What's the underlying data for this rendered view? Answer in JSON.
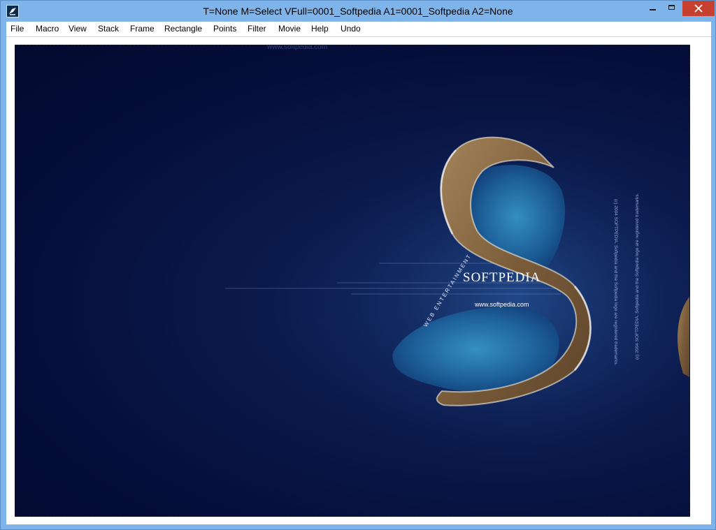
{
  "window": {
    "title": "T=None M=Select VFull=0001_Softpedia  A1=0001_Softpedia  A2=None",
    "icons": {
      "app": "app-logo-icon",
      "minimize": "minimize-icon",
      "maximize": "maximize-icon",
      "close": "close-icon"
    }
  },
  "menu": {
    "items": [
      {
        "label": "File"
      },
      {
        "label": "Macro"
      },
      {
        "label": "View"
      },
      {
        "label": "Stack"
      },
      {
        "label": "Frame"
      },
      {
        "label": "Rectangle"
      },
      {
        "label": "Points"
      },
      {
        "label": "Filter"
      },
      {
        "label": "Movie"
      },
      {
        "label": "Help"
      },
      {
        "label": "Undo"
      }
    ]
  },
  "image": {
    "watermark": "www.softpedia.com",
    "logo": "SOFTPEDIA",
    "url": "www.softpedia.com",
    "tagline": "WEB ENTERTAINMENT",
    "notice_left": "(c) 2004  SOFTPEDIA.  Softpedia and the Softpedia logo are registered trademarks.",
    "notice_right": "(c) 2004  SOFTPEDIA.  Softpedia and the Softpedia logo are registered trademarks.",
    "colors": {
      "deep_navy": "#050e3a",
      "ocean": "#16316a",
      "reef": "#3a8fc0",
      "rock": "#8a6b45"
    }
  }
}
